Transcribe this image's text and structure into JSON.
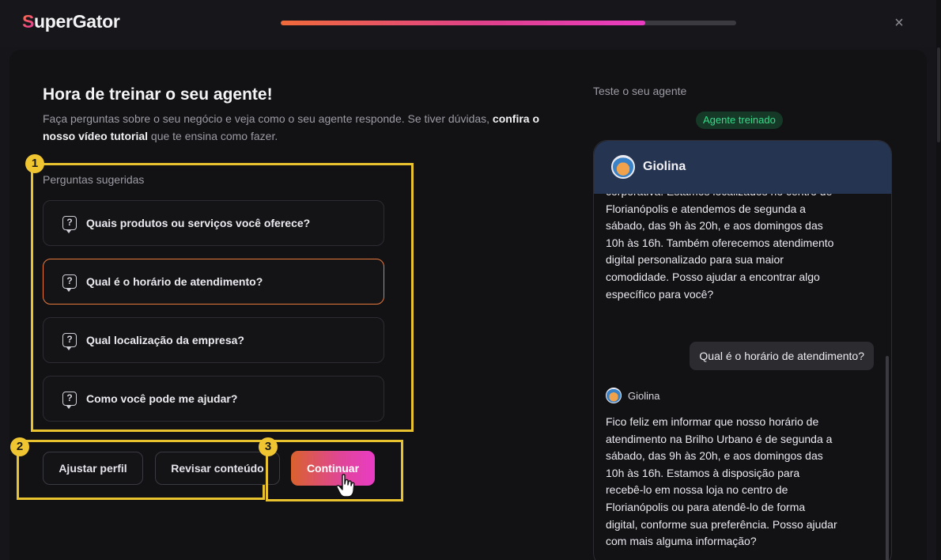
{
  "app": {
    "logo_initial": "S",
    "logo_rest": "uperGator",
    "progress_percent": 80,
    "close_glyph": "×"
  },
  "header": {
    "title": "Hora de treinar o seu agente!",
    "desc_lead": "Faça perguntas sobre o seu negócio e veja como o seu agente responde. Se tiver dúvidas, ",
    "desc_link": "confira o nosso vídeo tutorial",
    "desc_tail": " que te ensina como fazer."
  },
  "annotations": [
    "1",
    "2",
    "3"
  ],
  "suggestions": {
    "label": "Perguntas sugeridas",
    "items": [
      {
        "text": "Quais produtos ou serviços você oferece?",
        "icon": "question-bubble-icon"
      },
      {
        "text": "Qual é o horário de atendimento?",
        "icon": "question-bubble-icon"
      },
      {
        "text": "Qual localização da empresa?",
        "icon": "question-bubble-icon"
      },
      {
        "text": "Como você pode me ajudar?",
        "icon": "question-bubble-icon"
      }
    ]
  },
  "actions": {
    "adjust_profile": "Ajustar perfil",
    "review_content": "Revisar conteúdo",
    "continue": "Continuar"
  },
  "test_panel": {
    "label": "Teste o seu agente",
    "status_badge": "Agente treinado",
    "agent_name": "Giolina",
    "message_1": "corporativa. Estamos localizados no centro de Florianópolis e atendemos de segunda a sábado, das 9h às 20h, e aos domingos das 10h às 16h. Também oferecemos atendimento digital personalizado para sua maior comodidade. Posso ajudar a encontrar algo específico para você?",
    "user_message": "Qual é o horário de atendimento?",
    "message_2": "Fico feliz em informar que nosso horário de atendimento na Brilho Urbano é de segunda a sábado, das 9h às 20h, e aos domingos das 10h às 16h. Estamos à disposição para recebê-lo em nossa loja no centro de Florianópolis ou para atendê-lo de forma digital, conforme sua preferência. Posso ajudar com mais alguma informação?"
  },
  "colors": {
    "accent_orange": "#e8793d",
    "accent_pink": "#e93cc2",
    "annotation_yellow": "#e8c22f",
    "trained_green": "#39d98a",
    "chat_header": "#253450"
  }
}
